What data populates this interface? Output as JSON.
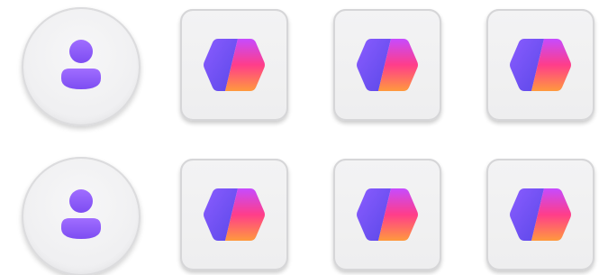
{
  "colors": {
    "avatar_purple_top": "#9b6bff",
    "avatar_purple_bottom": "#7a4cf0",
    "hex_purple": "#7b61ff",
    "hex_pink": "#ff3d8a",
    "hex_orange": "#ff8a3d",
    "button_surface": "#efeff1"
  },
  "rows": [
    {
      "avatar_button": {
        "icon": "user-avatar-icon"
      },
      "app_tiles": [
        {
          "icon": "hexagon-gradient-icon"
        },
        {
          "icon": "hexagon-gradient-icon"
        },
        {
          "icon": "hexagon-gradient-icon"
        }
      ]
    },
    {
      "avatar_button": {
        "icon": "user-avatar-icon"
      },
      "app_tiles": [
        {
          "icon": "hexagon-gradient-icon"
        },
        {
          "icon": "hexagon-gradient-icon"
        },
        {
          "icon": "hexagon-gradient-icon"
        }
      ]
    }
  ]
}
